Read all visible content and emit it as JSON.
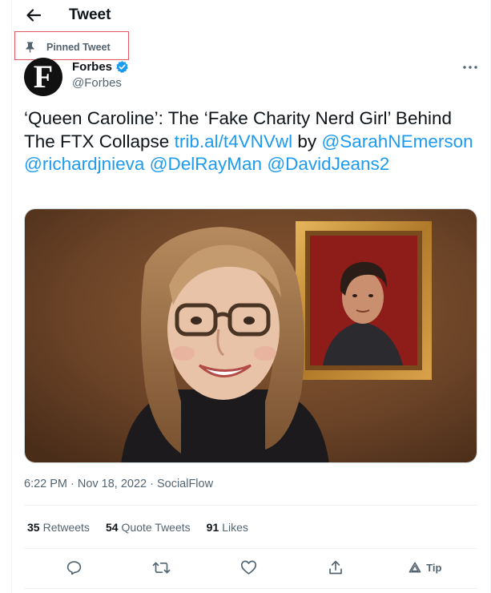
{
  "header": {
    "title": "Tweet",
    "back_icon": "arrow-left-icon"
  },
  "pinned": {
    "label": "Pinned Tweet",
    "icon": "pin-icon",
    "highlight_color": "#e0575f"
  },
  "author": {
    "avatar_letter": "F",
    "name": "Forbes",
    "handle": "@Forbes",
    "verified": true,
    "verified_color": "#1d9bf0"
  },
  "tweet": {
    "text_part1": "‘Queen Caroline’: The ‘Fake Charity Nerd Girl’ Behind The FTX Collapse",
    "link": "trib.al/t4VNVwl",
    "by": "by",
    "mentions": [
      "@SarahNEmerson",
      "@richardjnieva",
      "@DelRayMan",
      "@DavidJeans2"
    ],
    "link_color": "#1d9bf0"
  },
  "meta": {
    "time": "6:22 PM",
    "sep1": "·",
    "date": "Nov 18, 2022",
    "sep2": "·",
    "source": "SocialFlow"
  },
  "stats": {
    "retweets_count": "35",
    "retweets_label": "Retweets",
    "quotes_count": "54",
    "quotes_label": "Quote Tweets",
    "likes_count": "91",
    "likes_label": "Likes"
  },
  "actions": {
    "reply_icon": "reply-icon",
    "retweet_icon": "retweet-icon",
    "like_icon": "heart-icon",
    "share_icon": "share-icon",
    "tip_label": "Tip"
  }
}
